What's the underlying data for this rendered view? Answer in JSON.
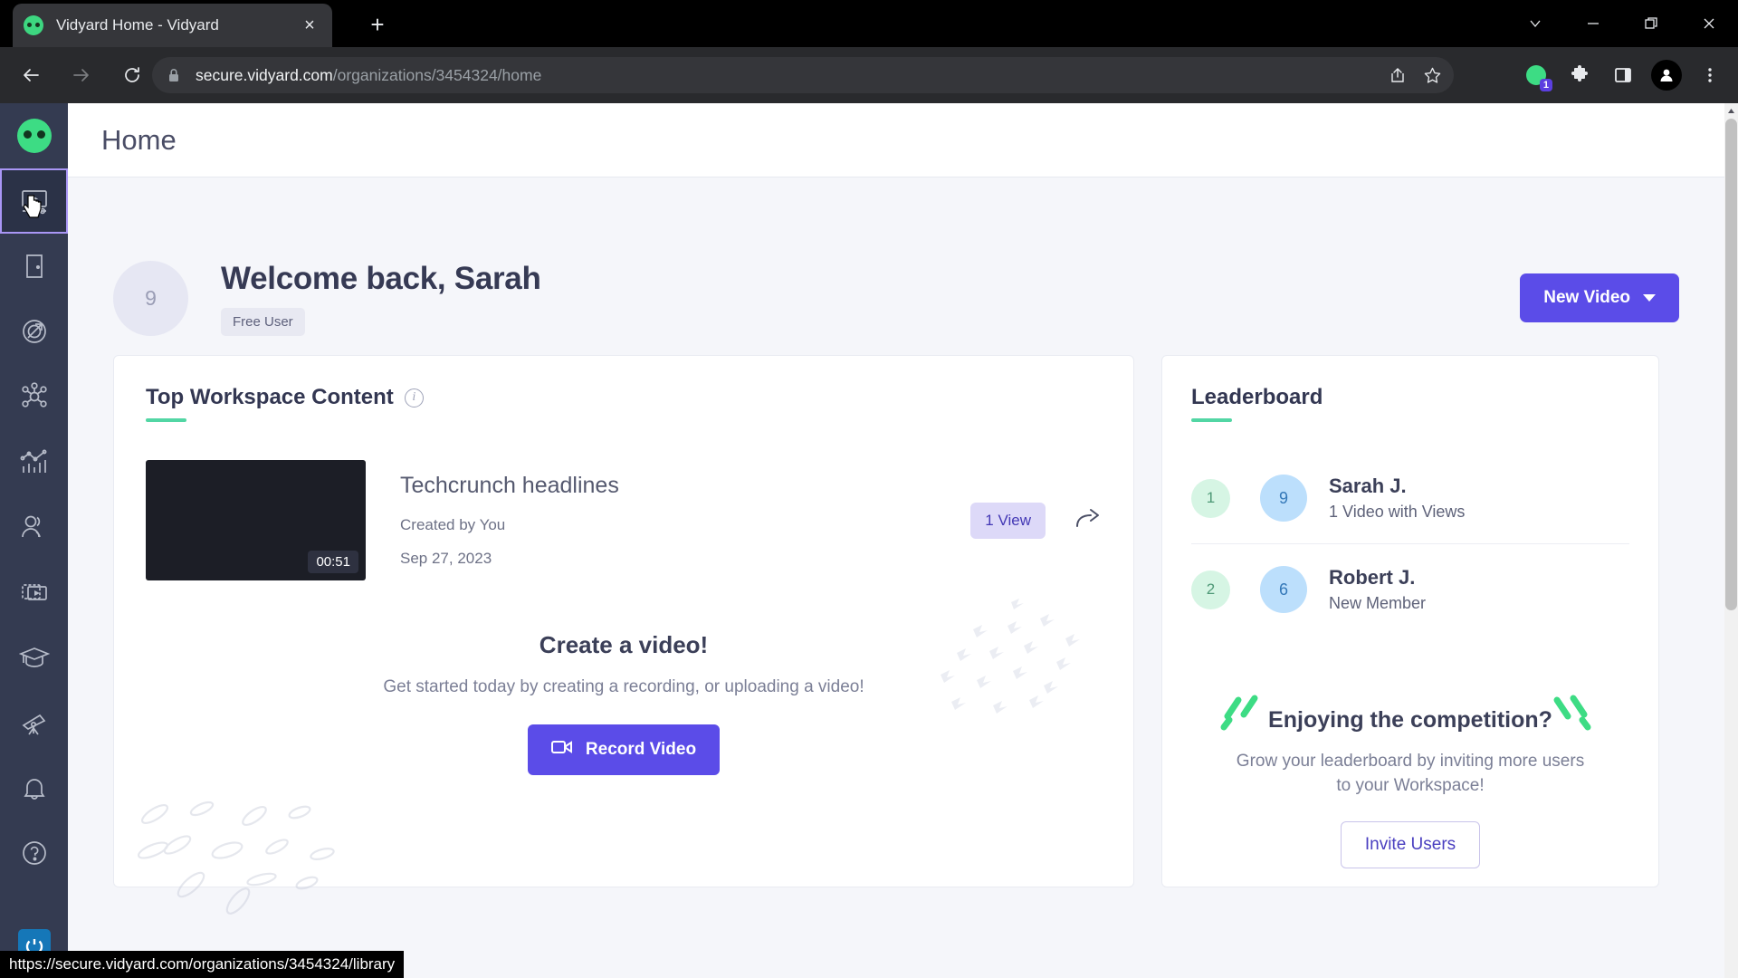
{
  "browser": {
    "tab": {
      "title": "Vidyard Home - Vidyard",
      "favicon": "vidyard-logo-icon",
      "close": "×"
    },
    "new_tab_label": "+",
    "window_controls": [
      "chevron-down-icon",
      "minimize-icon",
      "restore-icon",
      "close-icon"
    ],
    "url": {
      "scheme_host": "secure.vidyard.com",
      "path": "/organizations/3454324/home"
    },
    "extension_badge": "1",
    "status_bar_url": "https://secure.vidyard.com/organizations/3454324/library"
  },
  "sidebar": {
    "logo": "vidyard-robot-logo",
    "items": [
      {
        "name": "library",
        "icon": "video-player-icon",
        "selected": true
      },
      {
        "name": "rooms",
        "icon": "door-icon",
        "selected": false
      },
      {
        "name": "prospecting",
        "icon": "target-arrow-icon",
        "selected": false
      },
      {
        "name": "integrations",
        "icon": "network-nodes-icon",
        "selected": false
      },
      {
        "name": "analytics",
        "icon": "bar-chart-icon",
        "selected": false
      },
      {
        "name": "contacts",
        "icon": "users-icon",
        "selected": false
      },
      {
        "name": "playlists",
        "icon": "video-stack-icon",
        "selected": false
      },
      {
        "name": "learning",
        "icon": "graduation-cap-icon",
        "selected": false
      },
      {
        "name": "discover",
        "icon": "telescope-icon",
        "selected": false
      },
      {
        "name": "notifications",
        "icon": "bell-icon",
        "selected": false
      },
      {
        "name": "help",
        "icon": "question-circle-icon",
        "selected": false
      }
    ],
    "bottom_item": {
      "name": "support",
      "icon": "loop-logo-icon"
    }
  },
  "header": {
    "title": "Home"
  },
  "welcome": {
    "avatar_initial": "9",
    "greeting": "Welcome back, Sarah",
    "badge": "Free User",
    "new_video_button": "New Video"
  },
  "workspace_card": {
    "title": "Top Workspace Content",
    "info_glyph": "i",
    "video": {
      "title": "Techcrunch headlines",
      "created_by": "Created by You",
      "date": "Sep 27, 2023",
      "duration": "00:51",
      "views_badge": "1 View",
      "share_icon": "share-arrow-icon"
    },
    "empty_state": {
      "title": "Create a video!",
      "subtitle": "Get started today by creating a recording, or uploading a video!",
      "button": "Record Video",
      "button_icon": "camera-icon"
    }
  },
  "leaderboard": {
    "title": "Leaderboard",
    "rows": [
      {
        "rank": "1",
        "avatar": "9",
        "name": "Sarah J.",
        "meta": "1 Video with Views"
      },
      {
        "rank": "2",
        "avatar": "6",
        "name": "Robert J.",
        "meta": "New Member"
      }
    ],
    "promo": {
      "title": "Enjoying the competition?",
      "subtitle": "Grow your leaderboard by inviting more users to your Workspace!",
      "button": "Invite Users"
    }
  },
  "colors": {
    "accent_purple": "#5b4ce8",
    "accent_green": "#52d6a4",
    "sidebar_bg": "#343b51",
    "page_bg": "#f5f6fa",
    "badge_lavender": "#ddd9f8"
  }
}
